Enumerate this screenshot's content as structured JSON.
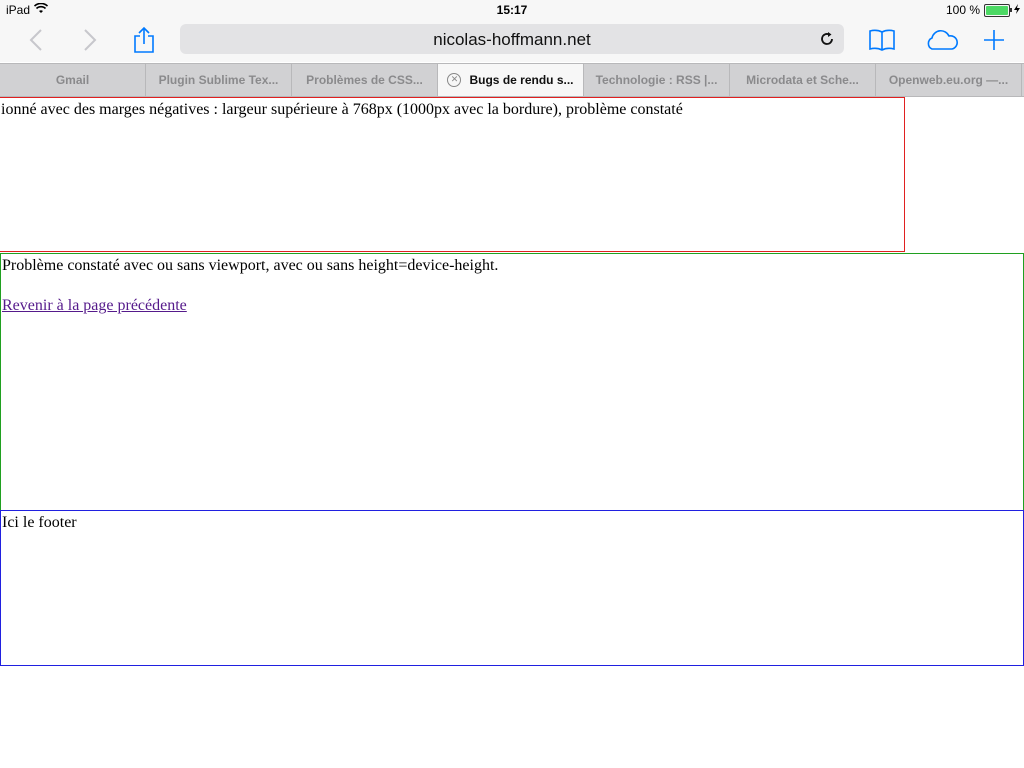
{
  "statusbar": {
    "device": "iPad",
    "time": "15:17",
    "battery_text": "100 %",
    "battery_level": 1.0
  },
  "toolbar": {
    "url": "nicolas-hoffmann.net",
    "icons": [
      "back-icon",
      "forward-icon",
      "share-icon",
      "reload-icon",
      "bookmarks-icon",
      "icloud-tabs-icon",
      "new-tab-icon"
    ]
  },
  "tabs": [
    {
      "label": "Gmail",
      "active": false
    },
    {
      "label": "Plugin Sublime Tex...",
      "active": false
    },
    {
      "label": "Problèmes de CSS...",
      "active": false
    },
    {
      "label": "Bugs de rendu s...",
      "active": true
    },
    {
      "label": "Technologie : RSS |...",
      "active": false
    },
    {
      "label": "Microdata et Sche...",
      "active": false
    },
    {
      "label": "Openweb.eu.org —...",
      "active": false
    }
  ],
  "page": {
    "red_block_text": "ionné avec des marges négatives : largeur supérieure à 768px (1000px avec la bordure), problème constaté",
    "green_block_text": "Problème constaté avec ou sans viewport, avec ou sans height=device-height.",
    "back_link": "Revenir à la page précédente",
    "footer_text": "Ici le footer"
  },
  "colors": {
    "accent": "#007aff",
    "red_border": "#e02020",
    "green_border": "#20a020",
    "blue_border": "#2020e0",
    "visited_link": "#551a8b"
  }
}
